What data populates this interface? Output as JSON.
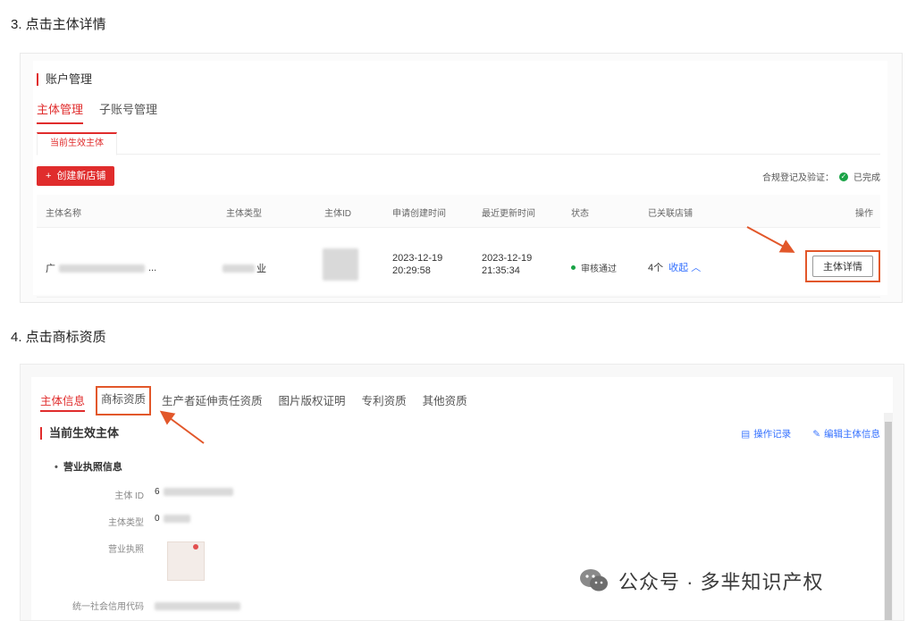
{
  "step3": "3. 点击主体详情",
  "step4": "4. 点击商标资质",
  "account": {
    "section_title": "账户管理",
    "tabs": [
      "主体管理",
      "子账号管理"
    ],
    "sub_tab": "当前生效主体",
    "create_button": "创建新店铺",
    "compliance_label": "合规登记及验证：",
    "compliance_status": "已完成",
    "columns": [
      "主体名称",
      "主体类型",
      "主体ID",
      "申请创建时间",
      "最近更新时间",
      "状态",
      "已关联店铺",
      "操作"
    ],
    "row": {
      "name_prefix": "广",
      "name_suffix": "...",
      "type_suffix": "业",
      "created_date": "2023-12-19",
      "created_time": "20:29:58",
      "updated_date": "2023-12-19",
      "updated_time": "21:35:34",
      "status": "审核通过",
      "shops_count": "4个",
      "collapse_link": "收起",
      "detail_button": "主体详情"
    }
  },
  "entity": {
    "tabs": [
      "主体信息",
      "商标资质",
      "生产者延伸责任资质",
      "图片版权证明",
      "专利资质",
      "其他资质"
    ],
    "current_title": "当前生效主体",
    "actions": [
      "操作记录",
      "编辑主体信息"
    ],
    "subsection": "营业执照信息",
    "fields": [
      "主体 ID",
      "主体类型",
      "营业执照",
      "统一社会信用代码"
    ],
    "field_prefixes": [
      "6",
      "0"
    ]
  },
  "watermark": "公众号 · 多芈知识产权",
  "colors": {
    "accent": "#e02c2c",
    "highlight": "#e2572a",
    "link": "#3370ff",
    "success": "#19a346"
  }
}
